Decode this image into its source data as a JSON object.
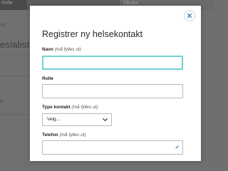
{
  "background": {
    "tab_left": "Rolle",
    "tab_right": "Tilbake",
    "small_text": "tet",
    "heading": "esialister",
    "arrow": "e"
  },
  "modal": {
    "title": "Registrer ny helsekontakt",
    "close_icon": "close-icon",
    "fields": {
      "navn": {
        "label": "Navn",
        "optional": "(må fylles ut)",
        "value": ""
      },
      "rolle": {
        "label": "Rolle",
        "value": ""
      },
      "type_kontakt": {
        "label": "Type kontakt",
        "optional": "(må fylles ut)",
        "selected": "Velg..."
      },
      "telefon": {
        "label": "Telefon",
        "optional": "(må fylles ut)",
        "value": ""
      }
    }
  },
  "colors": {
    "focus_border": "#6fd1d3",
    "close_icon": "#3a7fbf",
    "pen_icon": "#3a7fbf"
  }
}
